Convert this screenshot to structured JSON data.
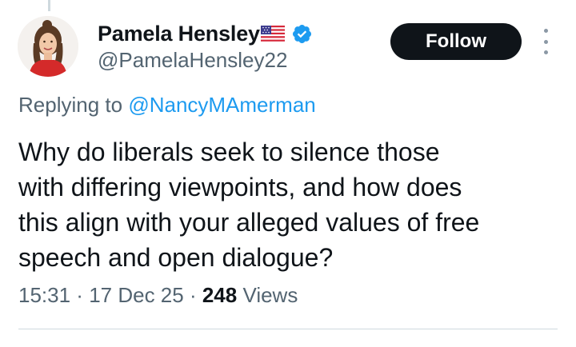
{
  "author": {
    "display_name": "Pamela Hensley",
    "handle": "@PamelaHensley22",
    "flag_icon": "us-flag-icon",
    "verified_icon": "verified-badge-icon"
  },
  "follow_button": {
    "label": "Follow"
  },
  "more_menu": {
    "icon": "more-vertical-icon"
  },
  "reply_context": {
    "prefix": "Replying to ",
    "mention": "@NancyMAmerman"
  },
  "tweet": {
    "text": "Why do liberals seek to silence those\nwith differing viewpoints, and how does\nthis align with your alleged values of free\nspeech and open dialogue?"
  },
  "meta": {
    "time": "15:31",
    "date": "17 Dec 25",
    "separator": " · ",
    "views_count": "248",
    "views_label": " Views"
  },
  "colors": {
    "text_primary": "#0f1419",
    "text_secondary": "#536471",
    "link": "#1d9bf0",
    "verified": "#1d9bf0",
    "button_bg": "#0f1419",
    "divider": "#cfd9de"
  }
}
